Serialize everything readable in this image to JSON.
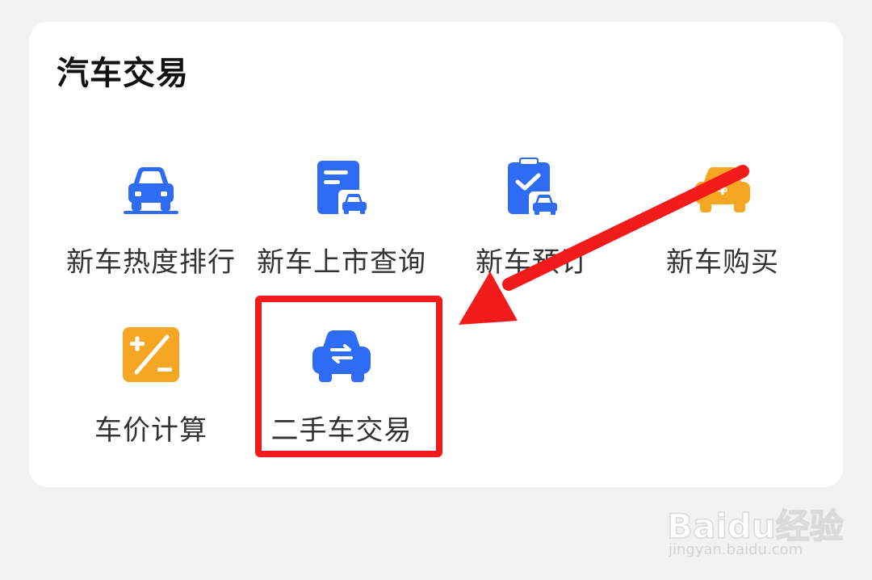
{
  "section": {
    "title": "汽车交易"
  },
  "tiles": [
    {
      "label": "新车热度排行",
      "icon": "car-front-icon",
      "color": "#2f6cf6"
    },
    {
      "label": "新车上市查询",
      "icon": "document-car-icon",
      "color": "#2f6cf6"
    },
    {
      "label": "新车预订",
      "icon": "clipboard-check-car-icon",
      "color": "#2f6cf6"
    },
    {
      "label": "新车购买",
      "icon": "car-yen-icon",
      "color": "#f5a623"
    },
    {
      "label": "车价计算",
      "icon": "calculator-plus-minus-icon",
      "color": "#f5a623"
    },
    {
      "label": "二手车交易",
      "icon": "car-exchange-icon",
      "color": "#2f6cf6"
    }
  ],
  "annotation": {
    "highlighted_item": "二手车交易",
    "color": "#f21b1b"
  },
  "watermark": {
    "brand": "Baidu经验",
    "url": "jingyan.baidu.com"
  }
}
